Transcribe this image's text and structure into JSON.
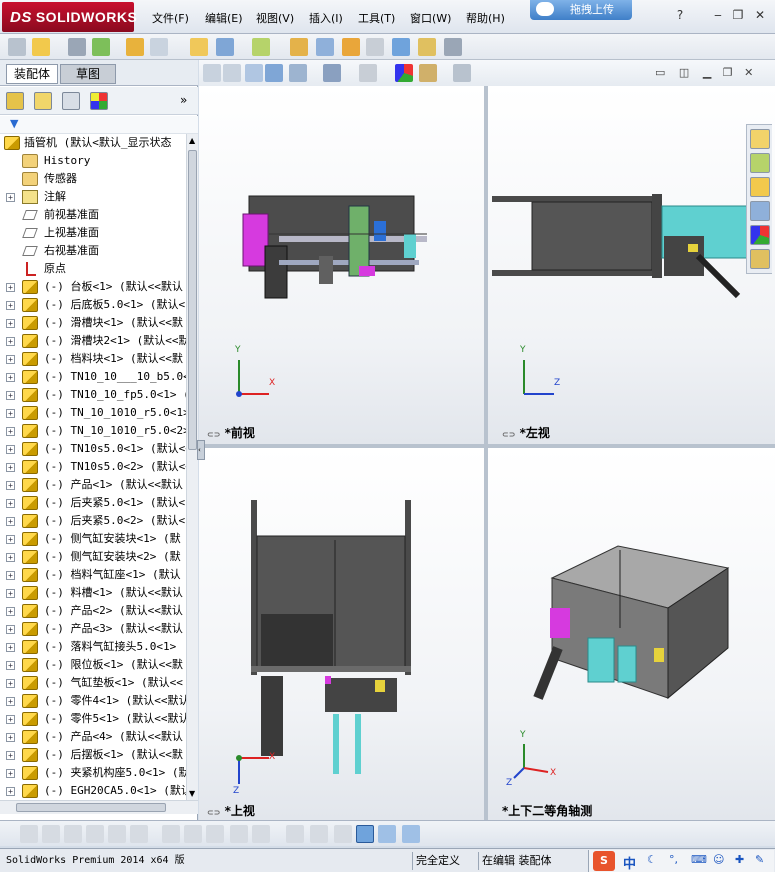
{
  "app": {
    "logo_text": "SOLIDWORKS",
    "logo_prefix": "DS"
  },
  "menu": [
    {
      "label": "文件(F)"
    },
    {
      "label": "编辑(E)"
    },
    {
      "label": "视图(V)"
    },
    {
      "label": "插入(I)"
    },
    {
      "label": "工具(T)"
    },
    {
      "label": "窗口(W)"
    },
    {
      "label": "帮助(H)"
    }
  ],
  "upload_label": "拖拽上传",
  "window_controls": [
    "minimize-icon",
    "restore-icon",
    "close-icon"
  ],
  "tabs": {
    "assembly": "装配体",
    "sketch": "草图"
  },
  "tree": {
    "root": "插管机  (默认<默认_显示状态",
    "items": [
      {
        "label": "History",
        "icon": "history-icon",
        "expand": false
      },
      {
        "label": "传感器",
        "icon": "sensor-icon",
        "expand": false
      },
      {
        "label": "注解",
        "icon": "annotation-icon",
        "expand": true
      },
      {
        "label": "前视基准面",
        "icon": "plane-icon",
        "expand": false
      },
      {
        "label": "上视基准面",
        "icon": "plane-icon",
        "expand": false
      },
      {
        "label": "右视基准面",
        "icon": "plane-icon",
        "expand": false
      },
      {
        "label": "原点",
        "icon": "origin-icon",
        "expand": false
      },
      {
        "label": "(-) 台板<1> (默认<<默认",
        "icon": "part-icon",
        "expand": true
      },
      {
        "label": "(-) 后底板5.0<1> (默认<",
        "icon": "part-icon",
        "expand": true
      },
      {
        "label": "(-) 滑槽块<1> (默认<<默",
        "icon": "part-icon",
        "expand": true
      },
      {
        "label": "(-) 滑槽块2<1> (默认<<默",
        "icon": "part-icon",
        "expand": true
      },
      {
        "label": "(-) 档料块<1> (默认<<默",
        "icon": "part-icon",
        "expand": true
      },
      {
        "label": "(-) TN10_10___10_b5.0<1",
        "icon": "part-icon",
        "expand": true
      },
      {
        "label": "(-) TN10_10_fp5.0<1> (",
        "icon": "part-icon",
        "expand": true
      },
      {
        "label": "(-) TN_10_1010_r5.0<1>",
        "icon": "part-icon",
        "expand": true
      },
      {
        "label": "(-) TN_10_1010_r5.0<2>",
        "icon": "part-icon",
        "expand": true
      },
      {
        "label": "(-) TN10s5.0<1> (默认<<",
        "icon": "part-icon",
        "expand": true
      },
      {
        "label": "(-) TN10s5.0<2> (默认<<",
        "icon": "part-icon",
        "expand": true
      },
      {
        "label": "(-) 产品<1> (默认<<默认",
        "icon": "part-icon",
        "expand": true
      },
      {
        "label": "(-) 后夹紧5.0<1> (默认<",
        "icon": "part-icon",
        "expand": true
      },
      {
        "label": "(-) 后夹紧5.0<2> (默认<",
        "icon": "part-icon",
        "expand": true
      },
      {
        "label": "(-) 侧气缸安装块<1> (默",
        "icon": "part-icon",
        "expand": true
      },
      {
        "label": "(-) 侧气缸安装块<2> (默",
        "icon": "part-icon",
        "expand": true
      },
      {
        "label": "(-) 档料气缸座<1> (默认",
        "icon": "part-icon",
        "expand": true
      },
      {
        "label": "(-) 料槽<1> (默认<<默认",
        "icon": "part-icon",
        "expand": true
      },
      {
        "label": "(-) 产品<2> (默认<<默认",
        "icon": "part-icon",
        "expand": true
      },
      {
        "label": "(-) 产品<3> (默认<<默认",
        "icon": "part-icon",
        "expand": true
      },
      {
        "label": "(-) 落料气缸接头5.0<1>",
        "icon": "part-icon",
        "expand": true
      },
      {
        "label": "(-) 限位板<1> (默认<<默",
        "icon": "part-icon",
        "expand": true
      },
      {
        "label": "(-) 气缸垫板<1> (默认<<",
        "icon": "part-icon",
        "expand": true
      },
      {
        "label": "(-) 零件4<1> (默认<<默认",
        "icon": "part-icon",
        "expand": true
      },
      {
        "label": "(-) 零件5<1> (默认<<默认",
        "icon": "part-icon",
        "expand": true
      },
      {
        "label": "(-) 产品<4> (默认<<默认",
        "icon": "part-icon",
        "expand": true
      },
      {
        "label": "(-) 后摆板<1> (默认<<默",
        "icon": "part-icon",
        "expand": true
      },
      {
        "label": "(-) 夹紧机构座5.0<1> (默",
        "icon": "part-icon",
        "expand": true
      },
      {
        "label": "(-) EGH20CA5.0<1> (默认",
        "icon": "part-icon",
        "expand": true
      }
    ]
  },
  "viewports": {
    "front": "*前视",
    "left": "*左视",
    "top": "*上视",
    "iso": "*上下二等角轴测"
  },
  "axes": {
    "x": "X",
    "y": "Y",
    "z": "Z"
  },
  "status": {
    "product": "SolidWorks Premium 2014 x64 版",
    "definition": "完全定义",
    "mode": "在编辑 装配体"
  },
  "ime": {
    "label": "中"
  },
  "colors": {
    "brand": "#c8102e",
    "accent": "#3f7fc8",
    "frame": "#4a4a4a",
    "magenta": "#d63adf",
    "cyan": "#5fd0d0"
  }
}
